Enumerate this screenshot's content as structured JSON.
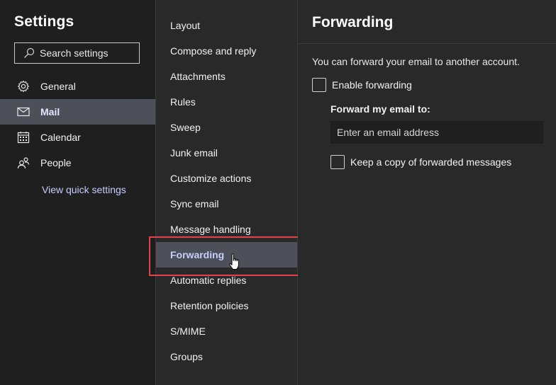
{
  "sidebar": {
    "title": "Settings",
    "search_placeholder": "Search settings",
    "items": [
      {
        "label": "General",
        "icon": "gear-icon"
      },
      {
        "label": "Mail",
        "icon": "mail-icon",
        "active": true
      },
      {
        "label": "Calendar",
        "icon": "calendar-icon"
      },
      {
        "label": "People",
        "icon": "people-icon"
      }
    ],
    "quick_settings_link": "View quick settings"
  },
  "mail_menu": {
    "items": [
      "Layout",
      "Compose and reply",
      "Attachments",
      "Rules",
      "Sweep",
      "Junk email",
      "Customize actions",
      "Sync email",
      "Message handling",
      "Forwarding",
      "Automatic replies",
      "Retention policies",
      "S/MIME",
      "Groups"
    ],
    "active": "Forwarding"
  },
  "forwarding": {
    "title": "Forwarding",
    "description": "You can forward your email to another account.",
    "enable_label": "Enable forwarding",
    "enable_checked": false,
    "forward_to_label": "Forward my email to:",
    "email_placeholder": "Enter an email address",
    "keep_copy_label": "Keep a copy of forwarded messages",
    "keep_copy_checked": false
  },
  "colors": {
    "background": "#1f1f1f",
    "panel": "#292929",
    "active_item": "#4d5059",
    "accent_text": "#c7cdfb",
    "highlight_border": "#e0434b"
  }
}
